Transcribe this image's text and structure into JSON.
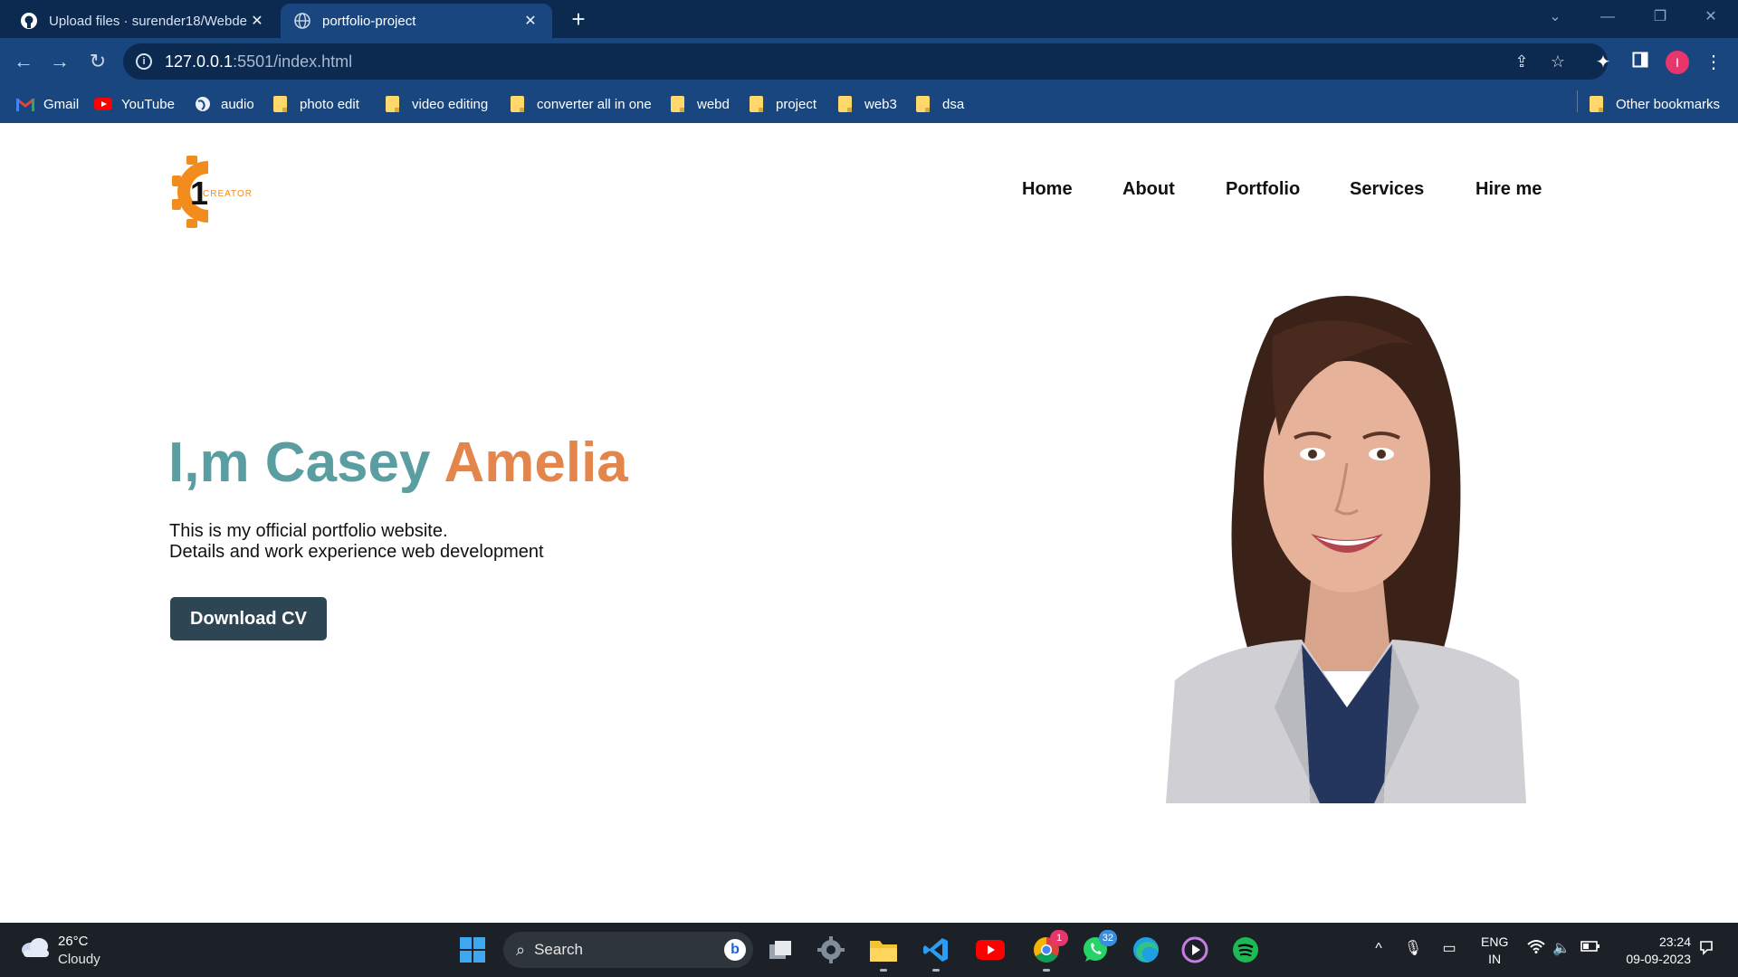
{
  "browser": {
    "tabs": [
      {
        "title": "Upload files · surender18/Webde",
        "icon": "github-icon",
        "active": false
      },
      {
        "title": "portfolio-project",
        "icon": "globe-icon",
        "active": true
      }
    ],
    "url_host": "127.0.0.1",
    "url_rest": ":5501/index.html",
    "bookmarks": [
      {
        "label": "Gmail",
        "icon": "gmail-icon"
      },
      {
        "label": "YouTube",
        "icon": "youtube-icon"
      },
      {
        "label": "audio",
        "icon": "globe-icon"
      },
      {
        "label": "photo edit",
        "icon": "folder-icon"
      },
      {
        "label": "video editing",
        "icon": "folder-icon"
      },
      {
        "label": "converter all in one",
        "icon": "folder-icon"
      },
      {
        "label": "webd",
        "icon": "folder-icon"
      },
      {
        "label": "project",
        "icon": "folder-icon"
      },
      {
        "label": "web3",
        "icon": "folder-icon"
      },
      {
        "label": "dsa",
        "icon": "folder-icon"
      }
    ],
    "other_bookmarks": "Other bookmarks",
    "profile_initial": "I"
  },
  "site": {
    "logo_number": "1",
    "logo_text": "CREATOR",
    "nav": [
      "Home",
      "About",
      "Portfolio",
      "Services",
      "Hire me"
    ],
    "hero": {
      "prefix": "I,m Casey",
      "highlight": "Amelia",
      "line1": "This is my official portfolio website.",
      "line2": "Details and work experience web development",
      "button": "Download CV"
    },
    "colors": {
      "name_teal": "#5b9ea1",
      "name_orange": "#e4854b",
      "button_bg": "#2e4654",
      "logo_orange": "#f28c1c"
    }
  },
  "taskbar": {
    "temperature": "26°C",
    "weather": "Cloudy",
    "search_placeholder": "Search",
    "chrome_badge": "1",
    "whatsapp_badge": "32",
    "lang_line1": "ENG",
    "lang_line2": "IN",
    "time": "23:24",
    "date": "09-09-2023"
  }
}
